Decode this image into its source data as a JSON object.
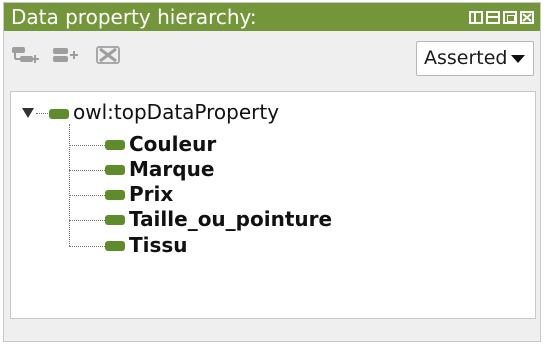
{
  "panel": {
    "title": "Data property hierarchy:",
    "window_controls": [
      "split-horizontal-icon",
      "split-vertical-icon",
      "maximize-icon",
      "close-icon"
    ],
    "accent_color": "#73963a"
  },
  "toolbar": {
    "icons": [
      "add-subproperty-icon",
      "add-sibling-property-icon",
      "delete-property-icon"
    ],
    "view_select": {
      "selected": "Asserted"
    }
  },
  "tree": {
    "root": {
      "label": "owl:topDataProperty",
      "expanded": true
    },
    "children": [
      {
        "label": "Couleur"
      },
      {
        "label": "Marque"
      },
      {
        "label": "Prix"
      },
      {
        "label": "Taille_ou_pointure"
      },
      {
        "label": "Tissu"
      }
    ],
    "property_icon_color": "#5e8c2c"
  }
}
